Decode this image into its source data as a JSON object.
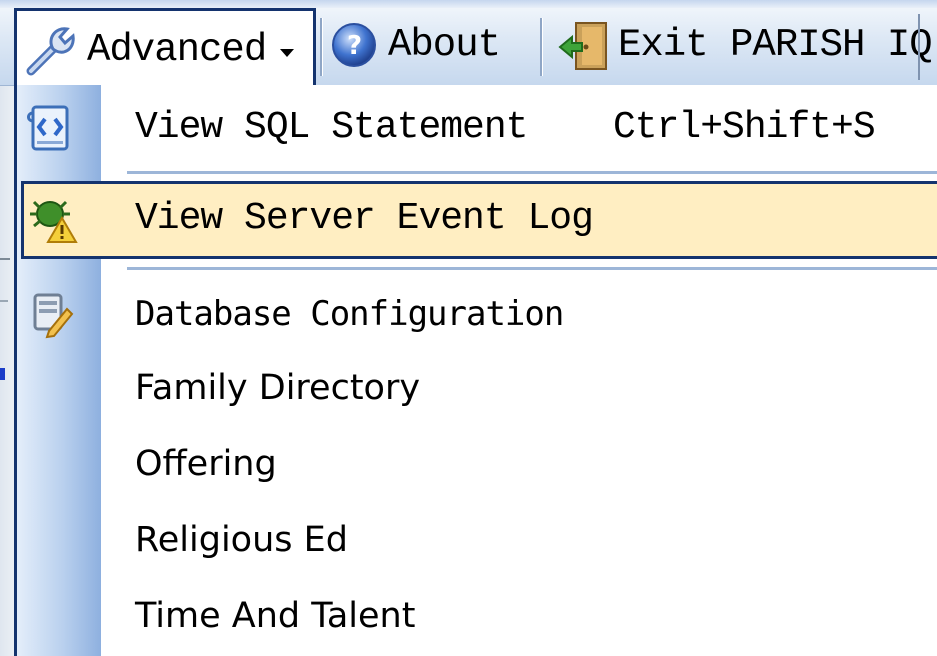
{
  "toolbar": {
    "advanced_label": "Advanced",
    "about_label": "About",
    "exit_label": "Exit PARISH IQ"
  },
  "menu": {
    "items": [
      {
        "label": "View SQL Statement",
        "shortcut": "Ctrl+Shift+S",
        "icon": "sql-script-icon"
      },
      {
        "label": "View Server Event Log",
        "icon": "event-log-bug-warning-icon",
        "highlighted": true
      },
      {
        "label": "Database Configuration",
        "icon": "database-config-icon"
      },
      {
        "label": "Family Directory"
      },
      {
        "label": "Offering"
      },
      {
        "label": "Religious Ed"
      },
      {
        "label": "Time And Talent"
      }
    ]
  },
  "colors": {
    "highlight_bg": "#ffeec2",
    "highlight_border": "#14336e",
    "gutter": "#b9d0ee"
  }
}
